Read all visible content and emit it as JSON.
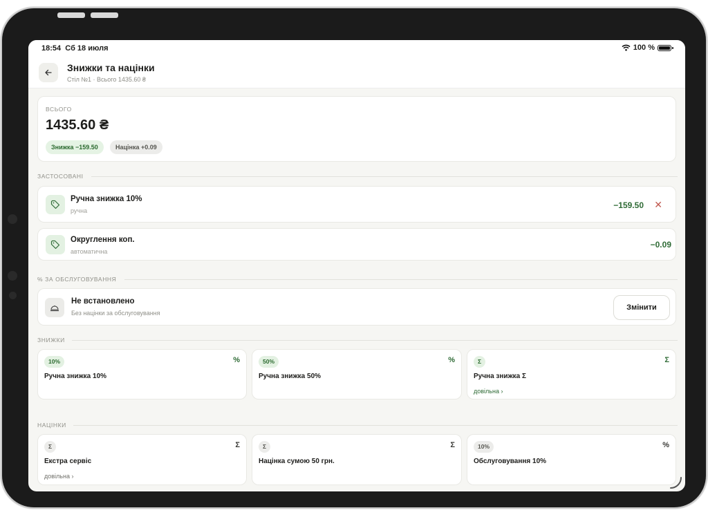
{
  "status_bar": {
    "time": "18:54",
    "date": "Сб 18 июля",
    "battery": "100 %"
  },
  "header": {
    "title": "Знижки та націнки",
    "subtitle": "Стіл №1 · Всього 1435.60 ₴"
  },
  "total": {
    "label": "ВСЬОГО",
    "amount": "1435.60 ₴",
    "discount_chip": "Знижка −159.50",
    "markup_chip": "Націнка +0.09"
  },
  "applied": {
    "section_label": "ЗАСТОСОВАНІ",
    "items": [
      {
        "title": "Ручна знижка 10%",
        "subtitle": "ручна",
        "amount": "−159.50",
        "removable": true
      },
      {
        "title": "Округлення коп.",
        "subtitle": "автоматична",
        "amount": "−0.09",
        "removable": false
      }
    ]
  },
  "service": {
    "section_label": "% ЗА ОБСЛУГОВУВАННЯ",
    "title": "Не встановлено",
    "subtitle": "Без націнки за обслуговування",
    "button": "Змінити"
  },
  "discounts": {
    "section_label": "ЗНИЖКИ",
    "tiles": [
      {
        "pill": "10%",
        "symbol": "%",
        "title": "Ручна знижка 10%",
        "link": ""
      },
      {
        "pill": "50%",
        "symbol": "%",
        "title": "Ручна знижка 50%",
        "link": ""
      },
      {
        "pill": "Σ",
        "symbol": "Σ",
        "title": "Ручна знижка Σ",
        "link": "довільна ›"
      }
    ]
  },
  "markups": {
    "section_label": "НАЦІНКИ",
    "tiles": [
      {
        "pill": "Σ",
        "symbol": "Σ",
        "title": "Екстра сервіс",
        "link": "довільна ›"
      },
      {
        "pill": "Σ",
        "symbol": "Σ",
        "title": "Націнка сумою 50 грн.",
        "link": ""
      },
      {
        "pill": "10%",
        "symbol": "%",
        "title": "Обслуговування 10%",
        "link": ""
      }
    ]
  },
  "icons": {
    "back": "arrow-left-icon",
    "tag": "tag-icon",
    "service": "cloche-icon",
    "remove": "close-icon",
    "wifi": "wifi-icon",
    "battery": "battery-icon"
  },
  "colors": {
    "accent_green": "#2f6b36",
    "chip_green_bg": "#e5f3e4",
    "danger": "#c0584e"
  }
}
